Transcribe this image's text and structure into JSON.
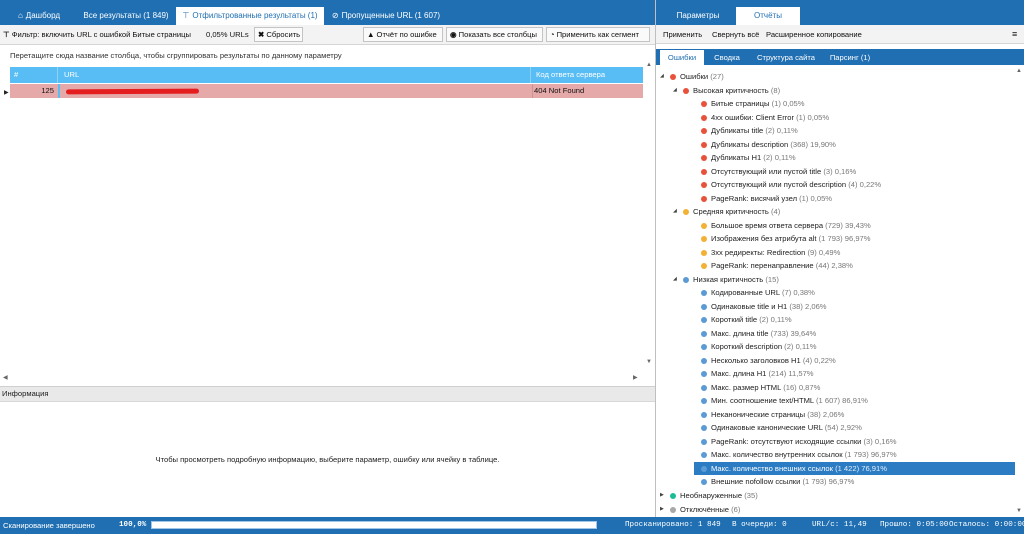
{
  "left_tabs": [
    {
      "icon": "⌂",
      "label": "Дашборд"
    },
    {
      "icon": "",
      "label": "Все результаты (1 849)"
    },
    {
      "icon": "⊤",
      "label": "Отфильтрованные результаты (1)"
    },
    {
      "icon": "⊘",
      "label": "Пропущенные URL (1 607)"
    }
  ],
  "toolbar": {
    "filter_label": "Фильтр: включить URL с ошибкой Битые страницы",
    "filter_percent": "0,05% URLs",
    "reset_label": "Сбросить",
    "report_label": "Отчёт по ошибке",
    "show_columns_label": "Показать все столбцы",
    "apply_segment_label": "Применить как сегмент"
  },
  "group_hint": "Перетащите сюда название столбца, чтобы сгруппировать результаты по данному параметру",
  "grid": {
    "columns": [
      "#",
      "URL",
      "Код ответа сервера"
    ],
    "rows": [
      {
        "num": "125",
        "url": "",
        "status": "404 Not Found"
      }
    ]
  },
  "info": {
    "header": "Информация",
    "placeholder": "Чтобы просмотреть подробную информацию, выберите параметр, ошибку или ячейку в таблице."
  },
  "right_tabs": [
    "Параметры",
    "Отчёты"
  ],
  "right_toolbar": {
    "apply": "Применить",
    "collapse_all": "Свернуть всё",
    "extended_copy": "Расширенное копирование"
  },
  "report_tabs": [
    "Ошибки",
    "Сводка",
    "Структура сайта",
    "Парсинг (1)"
  ],
  "colors": {
    "red": "#e8513a",
    "orange": "#f2b134",
    "blue": "#5b9bd5",
    "teal": "#1ebc96",
    "gray": "#a8a8a8"
  },
  "tree": {
    "errors_root": {
      "label": "Ошибки",
      "count": "(27)"
    },
    "high": {
      "label": "Высокая критичность",
      "count": "(8)"
    },
    "high_items": [
      {
        "label": "Битые страницы",
        "count": "(1) 0,05%"
      },
      {
        "label": "4xx ошибки: Client Error",
        "count": "(1) 0,05%"
      },
      {
        "label": "Дубликаты title",
        "count": "(2) 0,11%"
      },
      {
        "label": "Дубликаты description",
        "count": "(368) 19,90%"
      },
      {
        "label": "Дубликаты H1",
        "count": "(2) 0,11%"
      },
      {
        "label": "Отсутствующий или пустой title",
        "count": "(3) 0,16%"
      },
      {
        "label": "Отсутствующий или пустой description",
        "count": "(4) 0,22%"
      },
      {
        "label": "PageRank: висячий узел",
        "count": "(1) 0,05%"
      }
    ],
    "medium": {
      "label": "Средняя критичность",
      "count": "(4)"
    },
    "medium_items": [
      {
        "label": "Большое время ответа сервера",
        "count": "(729) 39,43%"
      },
      {
        "label": "Изображения без атрибута alt",
        "count": "(1 793) 96,97%"
      },
      {
        "label": "3xx редиректы: Redirection",
        "count": "(9) 0,49%"
      },
      {
        "label": "PageRank: перенаправление",
        "count": "(44) 2,38%"
      }
    ],
    "low": {
      "label": "Низкая критичность",
      "count": "(15)"
    },
    "low_items": [
      {
        "label": "Кодированные URL",
        "count": "(7) 0,38%"
      },
      {
        "label": "Одинаковые title и H1",
        "count": "(38) 2,06%"
      },
      {
        "label": "Короткий title",
        "count": "(2) 0,11%"
      },
      {
        "label": "Макс. длина title",
        "count": "(733) 39,64%"
      },
      {
        "label": "Короткий description",
        "count": "(2) 0,11%"
      },
      {
        "label": "Несколько заголовков H1",
        "count": "(4) 0,22%"
      },
      {
        "label": "Макс. длина H1",
        "count": "(214) 11,57%"
      },
      {
        "label": "Макс. размер HTML",
        "count": "(16) 0,87%"
      },
      {
        "label": "Мин. соотношение text/HTML",
        "count": "(1 607) 86,91%"
      },
      {
        "label": "Неканонические страницы",
        "count": "(38) 2,06%"
      },
      {
        "label": "Одинаковые канонические URL",
        "count": "(54) 2,92%"
      },
      {
        "label": "PageRank: отсутствуют исходящие ссылки",
        "count": "(3) 0,16%"
      },
      {
        "label": "Макс. количество внутренних ссылок",
        "count": "(1 793) 96,97%"
      },
      {
        "label": "Макс. количество внешних ссылок",
        "count": "(1 422) 76,91%"
      },
      {
        "label": "Внешние nofollow ссылки",
        "count": "(1 793) 96,97%"
      }
    ],
    "unimportant": {
      "label": "Необнаруженные",
      "count": "(35)"
    },
    "disabled": {
      "label": "Отключённые",
      "count": "(6)"
    }
  },
  "status": {
    "scan_state": "Сканирование завершено",
    "percent_text": "100,0%",
    "progress": 1.0,
    "scanned": "Просканировано: 1 849",
    "queue": "В очереди: 0",
    "url_rate": "URL/с: 11,49",
    "elapsed": "Прошло: 0:05:00",
    "remaining": "Осталось: 0:00:00"
  }
}
